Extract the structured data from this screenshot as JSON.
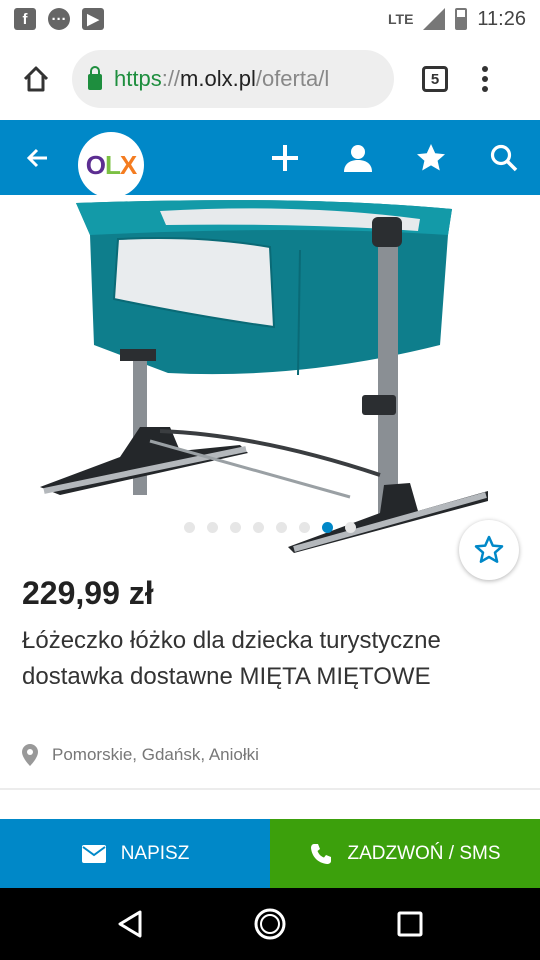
{
  "status_bar": {
    "network": "LTE",
    "time": "11:26",
    "icons": [
      "facebook-icon",
      "messenger-icon",
      "youtube-icon",
      "signal-icon",
      "battery-icon"
    ]
  },
  "browser": {
    "url_scheme": "https",
    "url_sep": "://",
    "url_host": "m.olx.pl",
    "url_path": "/oferta/l",
    "tab_count": "5"
  },
  "header": {
    "logo_o": "O",
    "logo_l": "L",
    "logo_x": "X"
  },
  "gallery": {
    "image_count": 8,
    "active_index": 6
  },
  "listing": {
    "price": "229,99 zł",
    "title": "Łóżeczko łóżko dla dziecka turystyczne dostawka dostawne MIĘTA MIĘTOWE",
    "location": "Pomorskie, Gdańsk, Aniołki"
  },
  "actions": {
    "message_label": "NAPISZ",
    "call_label": "ZADZWOŃ / SMS"
  },
  "colors": {
    "brand_blue": "#0088c8",
    "call_green": "#3ca00c",
    "secure_green": "#1e8e3e"
  }
}
